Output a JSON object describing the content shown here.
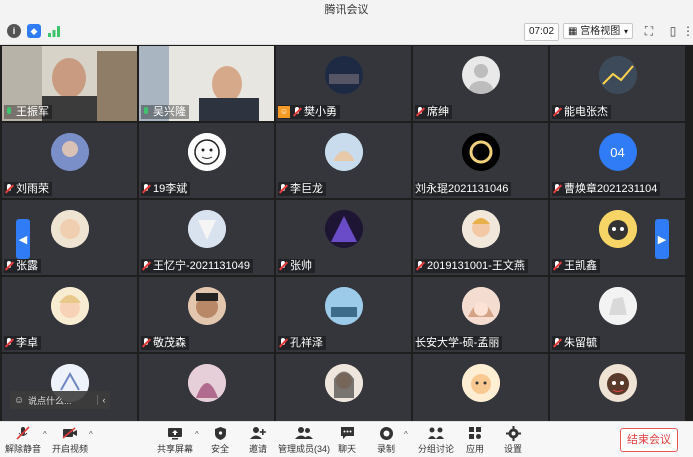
{
  "window": {
    "title": "腾讯会议"
  },
  "topbar": {
    "timer": "07:02",
    "view_label": "宫格视图"
  },
  "chat": {
    "placeholder": "说点什么..."
  },
  "participants": [
    {
      "name": "王振军",
      "mic": "on"
    },
    {
      "name": "吴兴隆",
      "mic": "on"
    },
    {
      "name": "樊小勇",
      "mic": "off"
    },
    {
      "name": "席绅",
      "mic": "off"
    },
    {
      "name": "能电张杰",
      "mic": "off"
    },
    {
      "name": "刘雨荣",
      "mic": "off"
    },
    {
      "name": "19李斌",
      "mic": "off"
    },
    {
      "name": "李巨龙",
      "mic": "off"
    },
    {
      "name": "刘永琨2021131046",
      "mic": "none"
    },
    {
      "name": "曹焕章2021231104",
      "mic": "off",
      "avatar_text": "04"
    },
    {
      "name": "张露",
      "mic": "off"
    },
    {
      "name": "王忆宁-2021131049",
      "mic": "off"
    },
    {
      "name": "张帅",
      "mic": "off"
    },
    {
      "name": "2019131001-王文燕",
      "mic": "off"
    },
    {
      "name": "王凯鑫",
      "mic": "off"
    },
    {
      "name": "李卓",
      "mic": "off"
    },
    {
      "name": "敬茂森",
      "mic": "off"
    },
    {
      "name": "孔祥泽",
      "mic": "off"
    },
    {
      "name": "长安大学-硕-孟丽",
      "mic": "none"
    },
    {
      "name": "朱留毓",
      "mic": "off"
    }
  ],
  "bottombar": {
    "unmute": "解除静音",
    "video": "开启视频",
    "share": "共享屏幕",
    "security": "安全",
    "invite": "邀请",
    "members": "管理成员(34)",
    "chat": "聊天",
    "record": "录制",
    "breakout": "分组讨论",
    "apps": "应用",
    "settings": "设置",
    "end": "结束会议"
  },
  "colors": {
    "accent": "#2f7cf6",
    "danger": "#e03c3c",
    "tile_bg": "#34363b"
  }
}
